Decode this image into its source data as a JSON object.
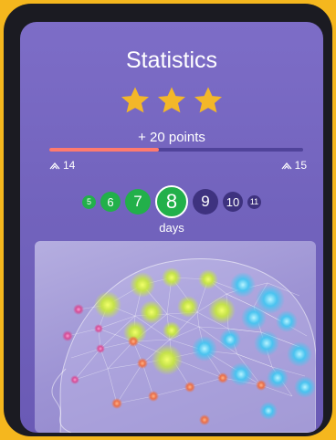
{
  "screen": {
    "title": "Statistics",
    "stars": {
      "earned": 3,
      "total": 3,
      "color": "#f3b729"
    },
    "points_text": "+ 20 points",
    "progress": {
      "fraction": 0.43,
      "fill_color": "#ff7a6e"
    },
    "level_left": "14",
    "level_right": "15",
    "day_numbers": [
      "5",
      "6",
      "7",
      "8",
      "9",
      "10",
      "11"
    ],
    "current_day": "8",
    "days_label": "days",
    "illustration": "brain-neural-network"
  }
}
